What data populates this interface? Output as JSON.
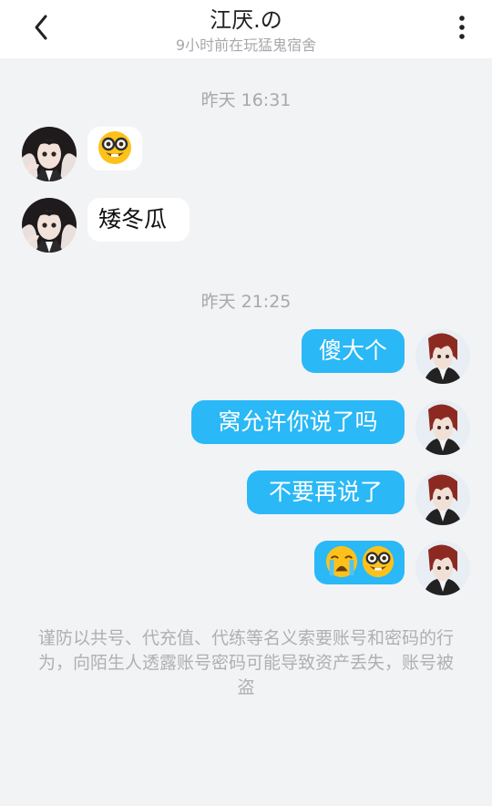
{
  "header": {
    "title": "江厌.の",
    "subtitle": "9小时前在玩猛鬼宿舍"
  },
  "messages": {
    "time_1": "昨天 16:31",
    "in_2_text": "矮冬瓜",
    "time_2": "昨天 21:25",
    "out_1_text": "傻大个",
    "out_2_text": "窝允许你说了吗",
    "out_3_text": "不要再说了"
  },
  "emojis": {
    "in_1": "nerd-face-emoji",
    "out_4": [
      "loudly-crying-face-emoji",
      "nerd-face-emoji"
    ]
  },
  "notice": {
    "text": "谨防以共号、代充值、代练等名义索要账号和密码的行为，向陌生人透露账号密码可能导致资产丢失，账号被盗"
  },
  "colors": {
    "background": "#f2f3f5",
    "outgoing_bubble": "#2ab8f6",
    "incoming_bubble": "#ffffff"
  }
}
